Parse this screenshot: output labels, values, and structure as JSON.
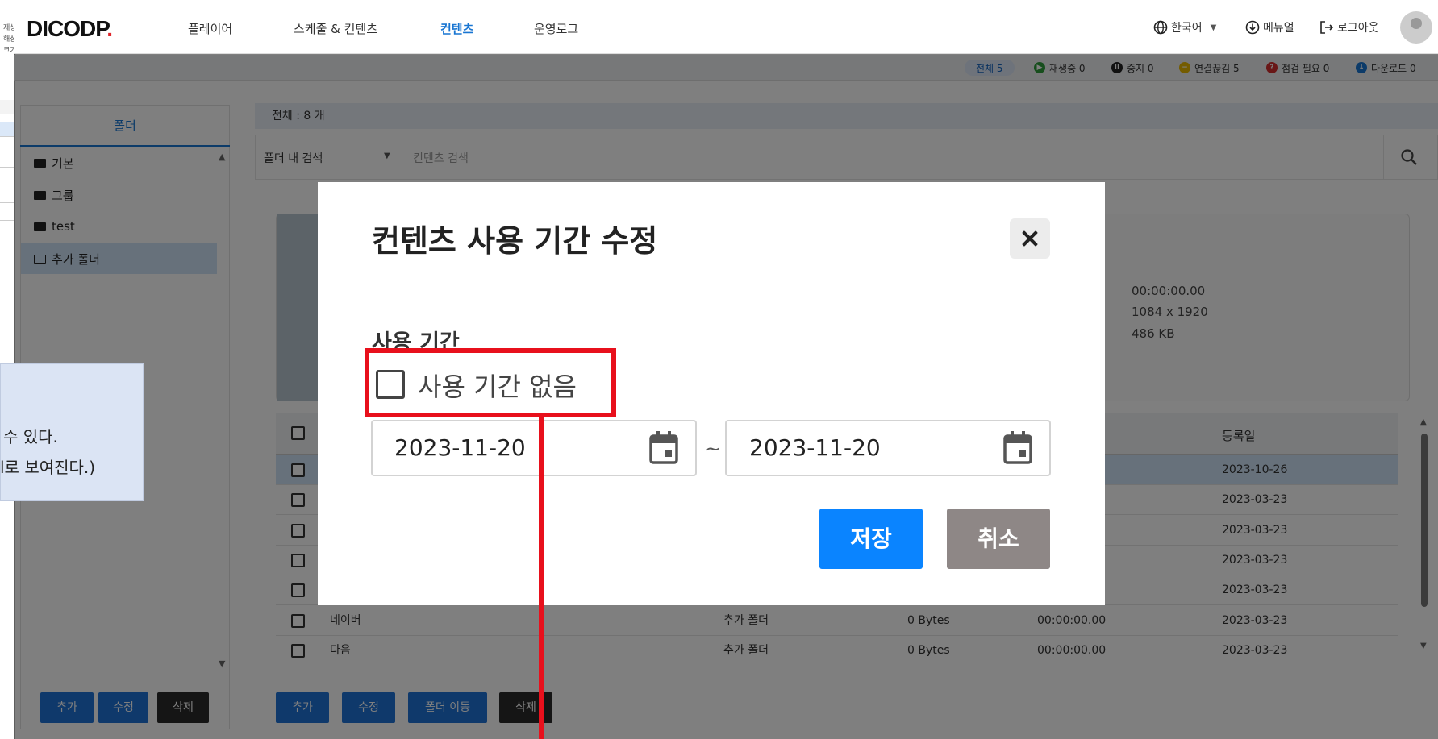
{
  "left_strip": {
    "lines": [
      "재생",
      "해상",
      "크기"
    ],
    "note_lines": [
      "수 있다.",
      "l로 보여진다.)"
    ]
  },
  "header": {
    "logo_text": "DICODP",
    "logo_dot": ".",
    "nav": [
      "플레이어",
      "스케줄 & 컨텐츠",
      "컨텐츠",
      "운영로그"
    ],
    "active_nav": "컨텐츠",
    "language": "한국어",
    "manual": "메뉴얼",
    "logout": "로그아웃"
  },
  "status": {
    "total": "전체 5",
    "playing": "재생중 0",
    "stopped": "중지 0",
    "disconnected": "연결끊김 5",
    "check_needed": "점검 필요 0",
    "download": "다운로드 0"
  },
  "folders": {
    "header": "폴더",
    "items": [
      "기본",
      "그룹",
      "test",
      "추가 폴더"
    ],
    "selected": "추가 폴더",
    "buttons": {
      "add": "추가",
      "edit": "수정",
      "delete": "삭제"
    }
  },
  "content": {
    "count": "전체 : 8 개",
    "search_scope": "폴더 내 검색",
    "search_placeholder": "컨텐츠 검색",
    "preview_meta": [
      "00:00:00.00",
      "1084 x 1920",
      "486 KB"
    ],
    "column_registered": "등록일",
    "rows": [
      {
        "name": "",
        "folder": "",
        "size": "",
        "duration": "",
        "date": "2023-10-26"
      },
      {
        "name": "",
        "folder": "",
        "size": "",
        "duration": "",
        "date": "2023-03-23"
      },
      {
        "name": "",
        "folder": "",
        "size": "",
        "duration": "",
        "date": "2023-03-23"
      },
      {
        "name": "",
        "folder": "",
        "size": "",
        "duration": "",
        "date": "2023-03-23"
      },
      {
        "name": "",
        "folder": "",
        "size": "",
        "duration": "",
        "date": "2023-03-23"
      },
      {
        "name": "네이버",
        "folder": "추가 폴더",
        "size": "0 Bytes",
        "duration": "00:00:00.00",
        "date": "2023-03-23"
      },
      {
        "name": "다음",
        "folder": "추가 폴더",
        "size": "0 Bytes",
        "duration": "00:00:00.00",
        "date": "2023-03-23"
      }
    ],
    "buttons": {
      "add": "추가",
      "edit": "수정",
      "move": "폴더 이동",
      "delete": "삭제"
    }
  },
  "modal": {
    "title": "컨텐츠 사용 기간 수정",
    "section_label": "사용 기간",
    "no_period_label": "사용 기간 없음",
    "no_period_checked": false,
    "start_date": "2023-11-20",
    "separator": "~",
    "end_date": "2023-11-20",
    "save": "저장",
    "cancel": "취소"
  },
  "colors": {
    "accent": "#1976d2",
    "save_button": "#0a84ff",
    "cancel_button": "#8e8786",
    "highlight": "#e8101c"
  }
}
